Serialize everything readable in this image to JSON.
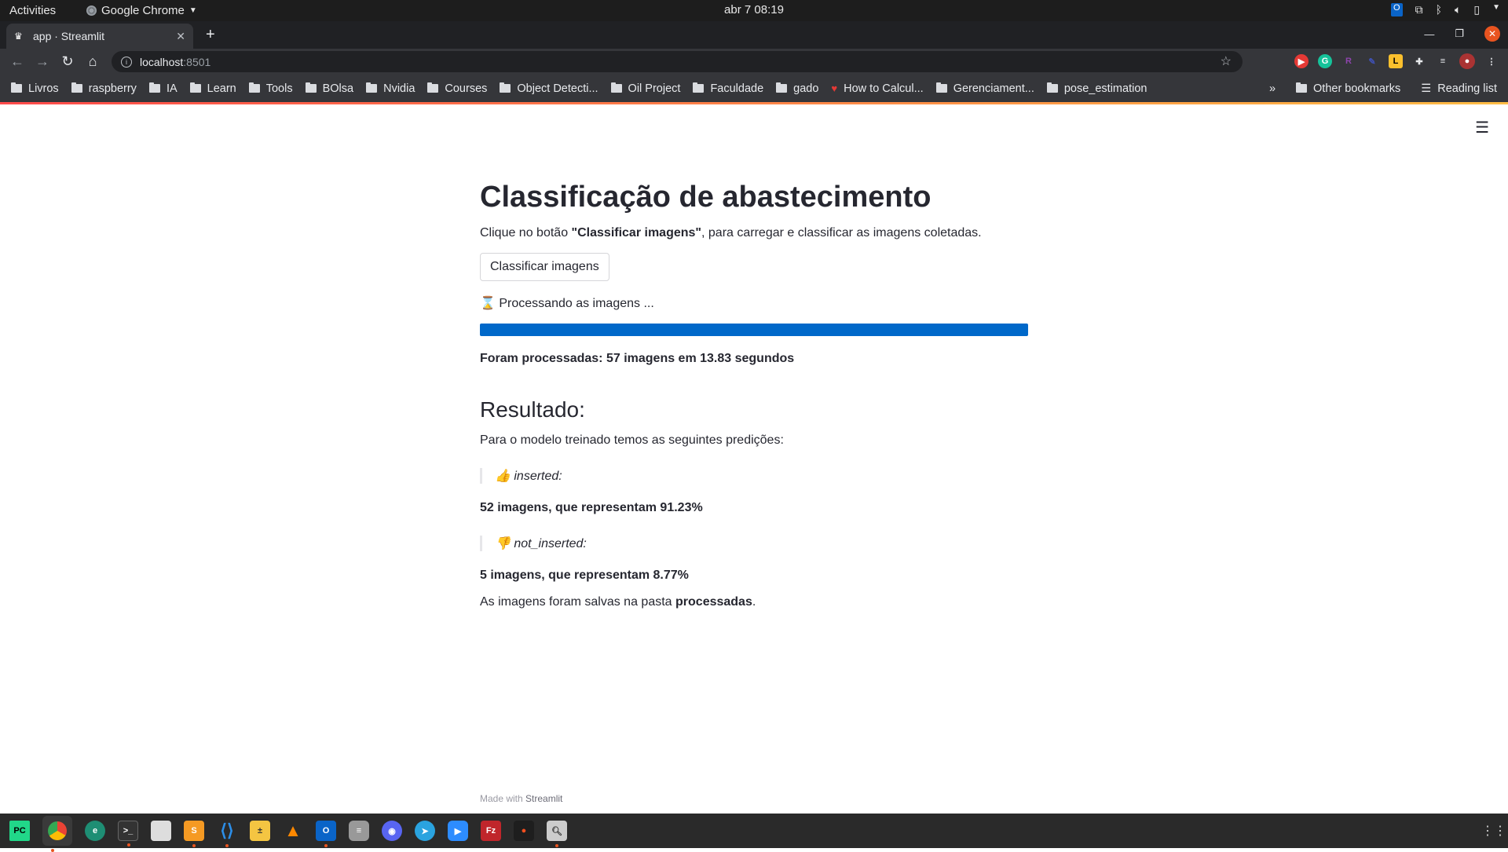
{
  "system": {
    "activities": "Activities",
    "app_name": "Google Chrome",
    "clock": "abr 7  08:19"
  },
  "browser": {
    "tab_title": "app · Streamlit",
    "url_host": "localhost",
    "url_port": ":8501"
  },
  "bookmarks": [
    "Livros",
    "raspberry",
    "IA",
    "Learn",
    "Tools",
    "BOlsa",
    "Nvidia",
    "Courses",
    "Object Detecti...",
    "Oil Project",
    "Faculdade",
    "gado",
    "How to Calcul...",
    "Gerenciament...",
    "pose_estimation"
  ],
  "bookmarks_right": {
    "more": "»",
    "other": "Other bookmarks",
    "reading": "Reading list"
  },
  "page": {
    "title": "Classificação de abastecimento",
    "intro_prefix": "Clique no botão ",
    "intro_bold": "\"Classificar imagens\"",
    "intro_suffix": ", para carregar e classificar as imagens coletadas.",
    "button_label": "Classificar imagens",
    "processing_text": "⌛ Processando as imagens ...",
    "progress_fraction": 1.0,
    "processed_summary": "Foram processadas: 57 imagens em 13.83 segundos",
    "result_heading": "Resultado:",
    "result_intro": "Para o modelo treinado temos as seguintes predições:",
    "class1_label": "👍 inserted:",
    "class1_summary": "52 imagens, que representam 91.23%",
    "class2_label": "👎 not_inserted:",
    "class2_summary": "5 imagens, que representam 8.77%",
    "saved_prefix": "As imagens foram salvas na pasta ",
    "saved_folder": "processadas",
    "saved_suffix": "."
  },
  "footer": {
    "made_with": "Made with ",
    "brand": "Streamlit"
  },
  "colors": {
    "progress": "#0068c9",
    "accent": "#ff4b4b"
  }
}
